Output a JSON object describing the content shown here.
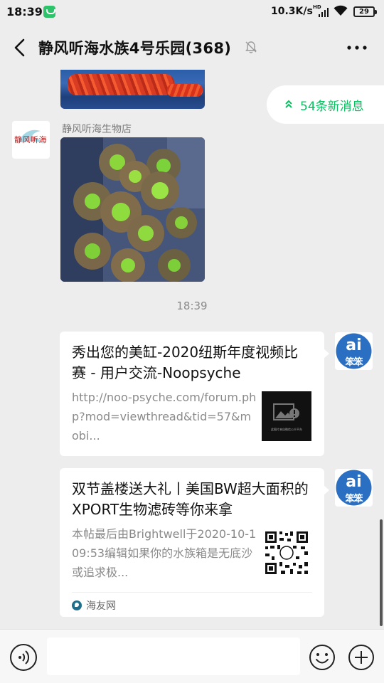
{
  "status_bar": {
    "time": "18:39",
    "network_speed": "10.3K/s",
    "network_type": "HD",
    "battery": "29",
    "icons": [
      "wechat-notification-icon",
      "hd-icon",
      "signal-icon",
      "wifi-icon",
      "battery-icon"
    ]
  },
  "header": {
    "title": "静风听海水族4号乐园(368)",
    "icons": [
      "back-arrow-icon",
      "mute-bell-icon",
      "more-dots-icon"
    ]
  },
  "new_messages": {
    "icon": "double-chevron-up-icon",
    "label": "54条新消息",
    "color": "#07c160"
  },
  "messages": {
    "shop": {
      "sender": "静风听海生物店",
      "avatar_text": "静风听海"
    },
    "timestamp": "18:39",
    "card1": {
      "title": "秀出您的美缸-2020纽斯年度视频比赛 - 用户交流-Noopsyche",
      "description": "http://noo-psyche.com/forum.php?mod=viewthread&tid=57&mobi...",
      "thumb_caption": "此图片来自微信公众平台"
    },
    "card2": {
      "title": "双节盖楼送大礼丨美国BW超大面积的XPORT生物滤砖等你来拿",
      "description": "本帖最后由Brightwell于2020-10-109:53编辑如果你的水族箱是无底沙或追求极...",
      "source": "海友网"
    },
    "ai_avatar_text": "笨笨"
  },
  "input_bar": {
    "placeholder": "",
    "icons": [
      "voice-icon",
      "emoji-icon",
      "plus-icon"
    ]
  },
  "colors": {
    "accent": "#07c160",
    "background": "#ededed",
    "card": "#ffffff"
  }
}
